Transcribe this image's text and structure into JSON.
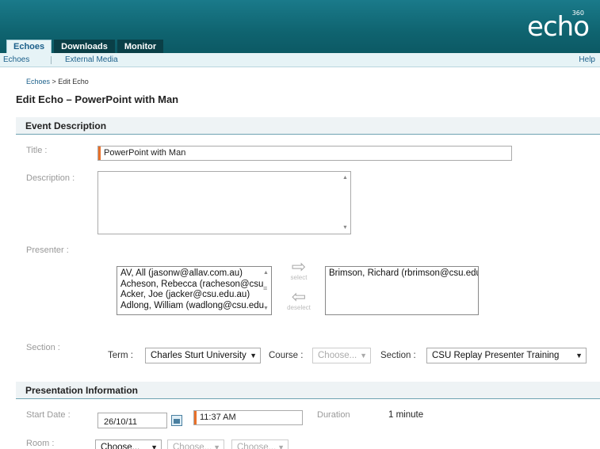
{
  "header": {
    "logo": "echo",
    "logo_super": "360",
    "tabs": [
      {
        "label": "Echoes",
        "active": true
      },
      {
        "label": "Downloads",
        "active": false
      },
      {
        "label": "Monitor",
        "active": false
      }
    ]
  },
  "subnav": {
    "items": [
      "Echoes",
      "External Media"
    ],
    "help": "Help"
  },
  "breadcrumb": {
    "link": "Echoes",
    "current": " > Edit Echo"
  },
  "page_title": "Edit Echo – PowerPoint with Man",
  "event_description": {
    "heading": "Event Description",
    "title_label": "Title :",
    "title_value": "PowerPoint with Man",
    "description_label": "Description :",
    "description_value": "",
    "presenter_label": "Presenter :",
    "available_presenters": [
      "AV, All (jasonw@allav.com.au)",
      "Acheson, Rebecca (racheson@csu",
      "Acker, Joe (jacker@csu.edu.au)",
      "Adlong, William (wadlong@csu.edu"
    ],
    "select_label": "select",
    "deselect_label": "deselect",
    "selected_presenters": [
      "Brimson, Richard (rbrimson@csu.edu"
    ],
    "section_label": "Section :",
    "term_label": "Term :",
    "term_value": "Charles Sturt University",
    "course_label": "Course :",
    "course_value": "Choose...",
    "section_field_label": "Section :",
    "section_value": "CSU Replay Presenter Training"
  },
  "presentation_information": {
    "heading": "Presentation Information",
    "start_date_label": "Start Date :",
    "start_date_value": "26/10/11",
    "start_time_value": "11:37 AM",
    "duration_label": "Duration",
    "duration_value": "1 minute",
    "room_label": "Room :",
    "room_selects": [
      "Choose...",
      "Choose...",
      "Choose..."
    ]
  },
  "colors": {
    "header_teal": "#0f6470",
    "accent_orange": "#e8702a",
    "link_blue": "#1b5f8a"
  }
}
